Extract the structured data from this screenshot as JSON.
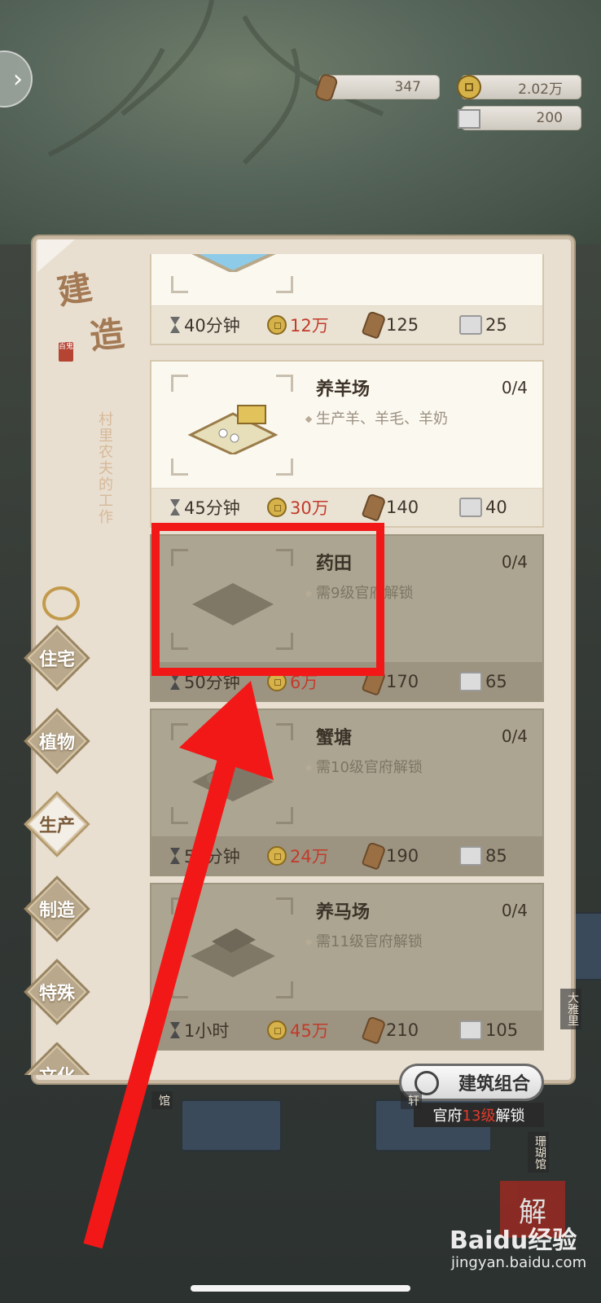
{
  "resources": {
    "wood": "347",
    "coin": "2.02万",
    "stone": "200"
  },
  "panel": {
    "title_chars": [
      "建",
      "造"
    ],
    "stamp": "百鬼",
    "subtitle": "村里农夫的工作"
  },
  "tabs": [
    {
      "label": "住宅",
      "active": false
    },
    {
      "label": "植物",
      "active": false
    },
    {
      "label": "生产",
      "active": true
    },
    {
      "label": "制造",
      "active": false
    },
    {
      "label": "特殊",
      "active": false
    },
    {
      "label": "文化",
      "active": false
    }
  ],
  "buildings": [
    {
      "name": "",
      "count": "",
      "desc": "",
      "time": "40分钟",
      "coin": "12万",
      "wood": "125",
      "stone": "25",
      "locked": false
    },
    {
      "name": "养羊场",
      "count": "0/4",
      "desc": "生产羊、羊毛、羊奶",
      "time": "45分钟",
      "coin": "30万",
      "wood": "140",
      "stone": "40",
      "locked": false
    },
    {
      "name": "药田",
      "count": "0/4",
      "desc": "需9级官府解锁",
      "time": "50分钟",
      "coin": "6万",
      "wood": "170",
      "stone": "65",
      "locked": true
    },
    {
      "name": "蟹塘",
      "count": "0/4",
      "desc": "需10级官府解锁",
      "time": "55分钟",
      "coin": "24万",
      "wood": "190",
      "stone": "85",
      "locked": true
    },
    {
      "name": "养马场",
      "count": "0/4",
      "desc": "需11级官府解锁",
      "time": "1小时",
      "coin": "45万",
      "wood": "210",
      "stone": "105",
      "locked": true
    }
  ],
  "combo": {
    "label": "建筑组合",
    "note_prefix": "官府",
    "note_level": "13级",
    "note_suffix": "解锁"
  },
  "side_labels": {
    "left": "馆",
    "mid": "轩",
    "right_top": "大雅里",
    "right_bottom": "珊瑚馆"
  },
  "watermark": {
    "brand": "Baidu经验",
    "url": "jingyan.baidu.com",
    "seal": "解"
  },
  "colors": {
    "highlight": "#f21818",
    "arrow": "#f21818",
    "price_red": "#c23b2b",
    "panel_bg": "#e8dfd1",
    "locked_card": "#aca592"
  }
}
